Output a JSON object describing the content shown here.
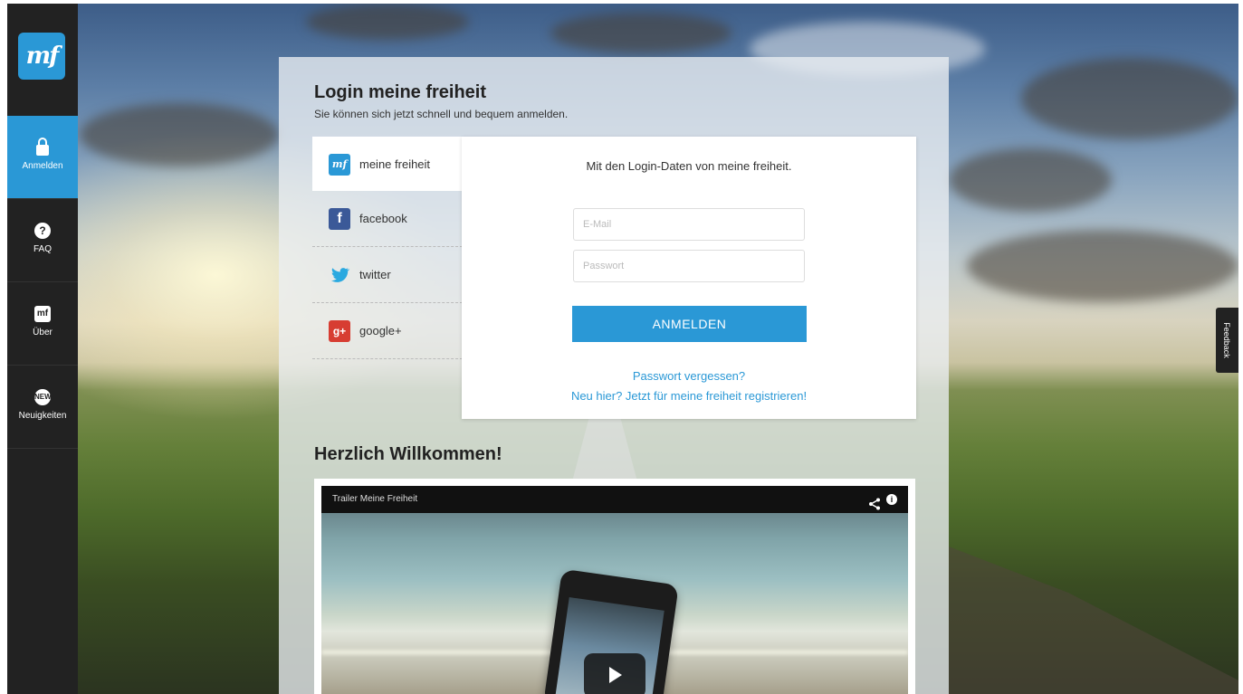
{
  "sidebar": {
    "logo": "mf",
    "items": [
      {
        "label": "Anmelden",
        "icon": "lock-icon",
        "active": true
      },
      {
        "label": "FAQ",
        "icon": "question-icon",
        "glyph": "?"
      },
      {
        "label": "Über",
        "icon": "about-icon",
        "glyph": "mf"
      },
      {
        "label": "Neuigkeiten",
        "icon": "news-badge-icon",
        "glyph": "NEW"
      }
    ]
  },
  "main": {
    "title": "Login meine freiheit",
    "subtitle": "Sie können sich jetzt schnell und bequem anmelden.",
    "tabs": [
      {
        "label": "meine freiheit",
        "icon": "meine-freiheit-icon",
        "glyph": "mf",
        "active": true
      },
      {
        "label": "facebook",
        "icon": "facebook-icon",
        "glyph": "f"
      },
      {
        "label": "twitter",
        "icon": "twitter-icon",
        "glyph": "🐦"
      },
      {
        "label": "google+",
        "icon": "google-plus-icon",
        "glyph": "g+"
      }
    ],
    "login": {
      "heading": "Mit den Login-Daten von meine freiheit.",
      "email_placeholder": "E-Mail",
      "password_placeholder": "Passwort",
      "submit_label": "ANMELDEN",
      "forgot_link": "Passwort vergessen?",
      "register_link": "Neu hier? Jetzt für meine freiheit registrieren!"
    },
    "welcome": "Herzlich Willkommen!",
    "video": {
      "title": "Trailer Meine Freiheit",
      "share_glyph": "<",
      "info_glyph": "i"
    }
  },
  "feedback_label": "Feedback",
  "colors": {
    "accent": "#2a98d6",
    "sidebar_bg": "#222222",
    "facebook": "#3b5998",
    "twitter": "#2aa9e0",
    "google_plus": "#d73d32"
  }
}
